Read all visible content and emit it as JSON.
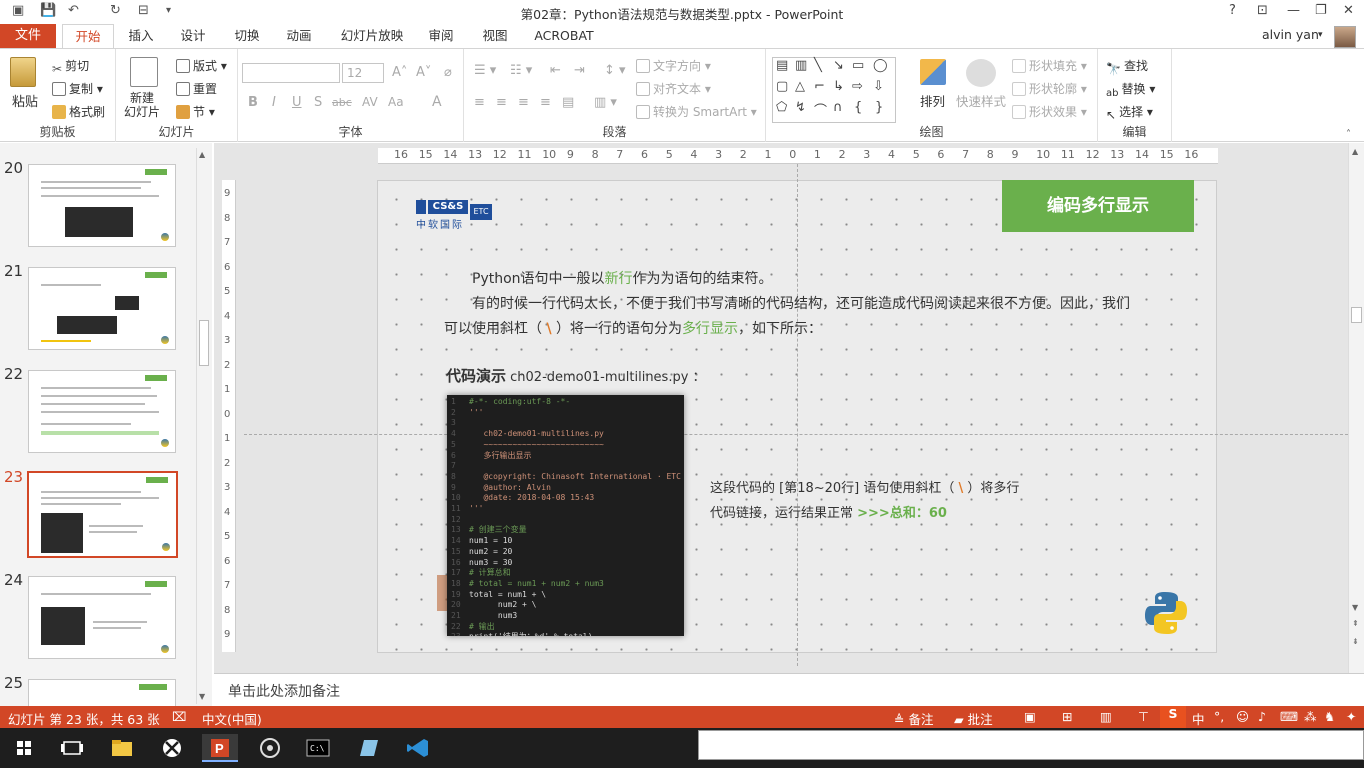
{
  "window": {
    "title": "第02章：Python语法规范与数据类型.pptx - PowerPoint",
    "controls": [
      "?",
      "⊡",
      "—",
      "❐",
      "✕"
    ]
  },
  "quick_access": [
    "save",
    "undo",
    "redo",
    "present"
  ],
  "tabs": [
    "文件",
    "开始",
    "插入",
    "设计",
    "切换",
    "动画",
    "幻灯片放映",
    "审阅",
    "视图",
    "ACROBAT"
  ],
  "active_tab": "开始",
  "user": "alvin yan",
  "ribbon": {
    "clipboard": {
      "label": "剪贴板",
      "paste": "粘贴",
      "cut": "剪切",
      "copy": "复制",
      "format_painter": "格式刷"
    },
    "slides": {
      "label": "幻灯片",
      "new_slide": "新建\n幻灯片",
      "layout": "版式",
      "reset": "重置",
      "section": "节"
    },
    "font": {
      "label": "字体",
      "font_name": "",
      "font_size": "12",
      "bold": "B",
      "italic": "I",
      "underline": "U",
      "shadow": "S",
      "strike": "abc",
      "spacing": "AV",
      "case": "Aa",
      "color": "A"
    },
    "paragraph": {
      "label": "段落",
      "text_direction": "文字方向",
      "align_text": "对齐文本",
      "smartart": "转换为 SmartArt"
    },
    "drawing": {
      "label": "绘图",
      "arrange": "排列",
      "quick_styles": "快速样式",
      "shape_fill": "形状填充",
      "shape_outline": "形状轮廓",
      "shape_effects": "形状效果"
    },
    "editing": {
      "label": "编辑",
      "find": "查找",
      "replace": "替换",
      "select": "选择"
    }
  },
  "thumbnails": [
    {
      "num": "20"
    },
    {
      "num": "21"
    },
    {
      "num": "22"
    },
    {
      "num": "23",
      "selected": true
    },
    {
      "num": "24"
    },
    {
      "num": "25"
    }
  ],
  "ruler": {
    "h": [
      "16",
      "15",
      "14",
      "13",
      "12",
      "11",
      "10",
      "9",
      "8",
      "7",
      "6",
      "5",
      "4",
      "3",
      "2",
      "1",
      "0",
      "1",
      "2",
      "3",
      "4",
      "5",
      "6",
      "7",
      "8",
      "9",
      "10",
      "11",
      "12",
      "13",
      "14",
      "15",
      "16"
    ],
    "v": [
      "9",
      "8",
      "7",
      "6",
      "5",
      "4",
      "3",
      "2",
      "1",
      "0",
      "1",
      "2",
      "3",
      "4",
      "5",
      "6",
      "7",
      "8",
      "9"
    ]
  },
  "slide": {
    "logo_text": "CS&S",
    "logo_sub": "中软国际",
    "logo_etc": "ETC",
    "title": "编码多行显示",
    "line1_a": "Python语句中一般以",
    "line1_b": "新行",
    "line1_c": "作为为语句的结束符。",
    "line2": "有的时候一行代码太长，不便于我们书写清晰的代码结构，还可能造成代码阅读起来很不方便。因此，我们",
    "line3_a": "可以使用斜杠（ ",
    "line3_b": "\\",
    "line3_c": " ）将一行的语句分为",
    "line3_d": "多行显示",
    "line3_e": "，如下所示：",
    "demo_label": "代码演示",
    "demo_file": " ch02-demo01-multilines.py ：",
    "note_line1_a": "这段代码的 [第18~20行] 语句使用斜杠（ ",
    "note_line1_b": "\\",
    "note_line1_c": " ）将多行",
    "note_line2_a": "代码链接，运行结果正常 ",
    "note_line2_b": ">>>总和：60",
    "code": [
      {
        "ln": "1",
        "text": "#-*- coding:utf-8 -*-",
        "color": "#6a9955"
      },
      {
        "ln": "2",
        "text": "'''",
        "color": "#ce9178"
      },
      {
        "ln": "3",
        "text": "",
        "color": "#ce9178"
      },
      {
        "ln": "4",
        "text": "   ch02-demo01-multilines.py",
        "color": "#ce9178"
      },
      {
        "ln": "5",
        "text": "   ~~~~~~~~~~~~~~~~~~~~~~~~~",
        "color": "#ce9178"
      },
      {
        "ln": "6",
        "text": "   多行输出显示",
        "color": "#ce9178"
      },
      {
        "ln": "7",
        "text": "",
        "color": "#ce9178"
      },
      {
        "ln": "8",
        "text": "   @copyright: Chinasoft International · ETC",
        "color": "#ce9178"
      },
      {
        "ln": "9",
        "text": "   @author: Alvin",
        "color": "#ce9178"
      },
      {
        "ln": "10",
        "text": "   @date: 2018-04-08 15:43",
        "color": "#ce9178"
      },
      {
        "ln": "11",
        "text": "'''",
        "color": "#ce9178"
      },
      {
        "ln": "12",
        "text": "",
        "color": "#ce9178"
      },
      {
        "ln": "13",
        "text": "# 创建三个变量",
        "color": "#6a9955"
      },
      {
        "ln": "14",
        "text": "num1 = 10",
        "color": "#dcdcdc"
      },
      {
        "ln": "15",
        "text": "num2 = 20",
        "color": "#dcdcdc"
      },
      {
        "ln": "16",
        "text": "num3 = 30",
        "color": "#dcdcdc"
      },
      {
        "ln": "17",
        "text": "# 计算总和",
        "color": "#6a9955"
      },
      {
        "ln": "18",
        "text": "# total = num1 + num2 + num3",
        "color": "#6a9955"
      },
      {
        "ln": "19",
        "text": "total = num1 + \\",
        "color": "#dcdcdc"
      },
      {
        "ln": "20",
        "text": "      num2 + \\",
        "color": "#dcdcdc"
      },
      {
        "ln": "21",
        "text": "      num3",
        "color": "#dcdcdc"
      },
      {
        "ln": "22",
        "text": "# 输出",
        "color": "#6a9955"
      },
      {
        "ln": "23",
        "text": "print('结果为：%d' % total)",
        "color": "#dcdcdc"
      }
    ]
  },
  "notes_placeholder": "单击此处添加备注",
  "status": {
    "slide_info": "幻灯片 第 23 张，共 63 张",
    "language": "中文(中国)",
    "notes": "备注",
    "comments": "批注"
  },
  "colors": {
    "accent": "#d24726",
    "title_green": "#6ab04c",
    "logo_blue": "#1f4e9b"
  }
}
